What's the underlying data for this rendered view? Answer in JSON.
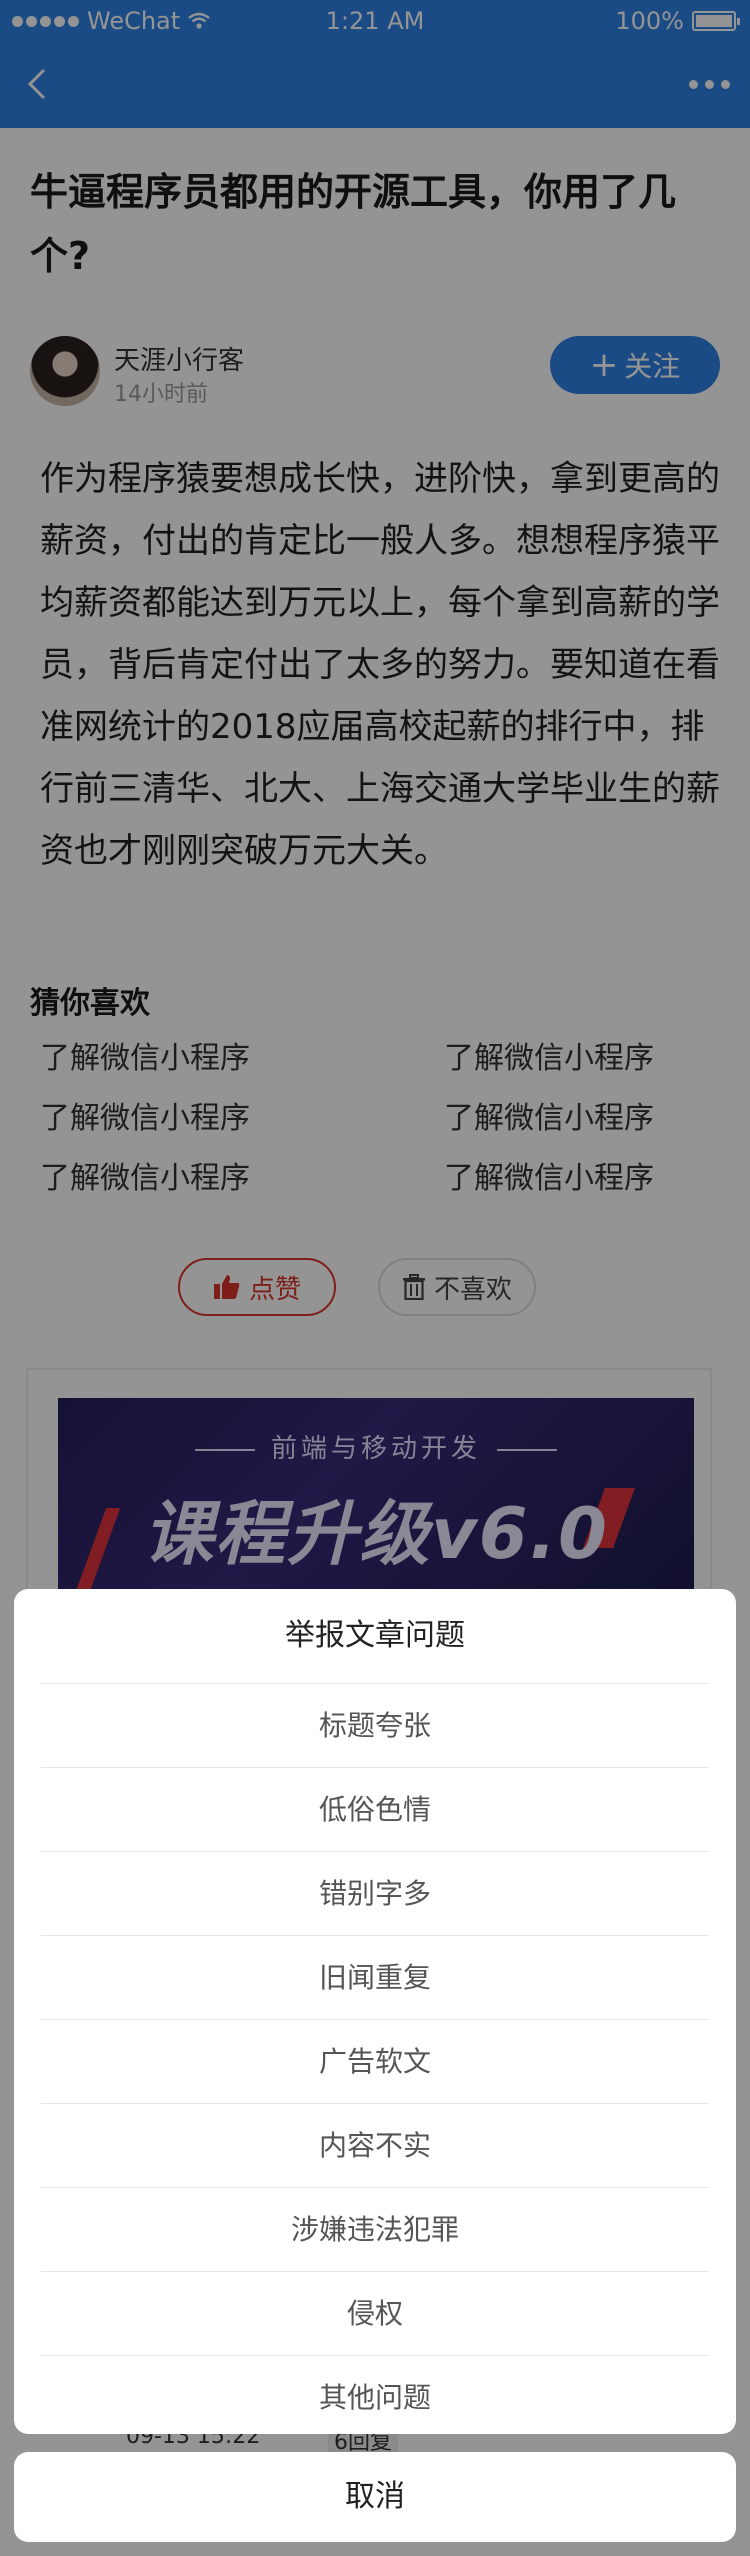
{
  "status_bar": {
    "carrier": "WeChat",
    "time": "1:21 AM",
    "battery": "100%"
  },
  "article": {
    "title": "牛逼程序员都用的开源工具，你用了几个?",
    "author": {
      "name": "天涯小行客",
      "time": "14小时前",
      "follow_label": "关注"
    },
    "body": "作为程序猿要想成长快，进阶快，拿到更高的薪资，付出的肯定比一般人多。想想程序猿平均薪资都能达到万元以上，每个拿到高薪的学员，背后肯定付出了太多的努力。要知道在看准网统计的2018应届高校起薪的排行中，排行前三清华、北大、上海交通大学毕业生的薪资也才刚刚突破万元大关。"
  },
  "guess": {
    "title": "猜你喜欢",
    "items": [
      "了解微信小程序",
      "了解微信小程序",
      "了解微信小程序",
      "了解微信小程序",
      "了解微信小程序",
      "了解微信小程序"
    ]
  },
  "actions": {
    "like_label": "点赞",
    "dislike_label": "不喜欢"
  },
  "ad": {
    "subtitle": "前端与移动开发",
    "headline": "课程升级v6.0"
  },
  "comment_peek": {
    "time": "09-13 15:22",
    "replies": "6回复"
  },
  "report_sheet": {
    "title": "举报文章问题",
    "options": [
      "标题夸张",
      "低俗色情",
      "错别字多",
      "旧闻重复",
      "广告软文",
      "内容不实",
      "涉嫌违法犯罪",
      "侵权",
      "其他问题"
    ],
    "cancel_label": "取消"
  },
  "colors": {
    "primary": "#2f82e4",
    "like_red": "#d9352b"
  }
}
